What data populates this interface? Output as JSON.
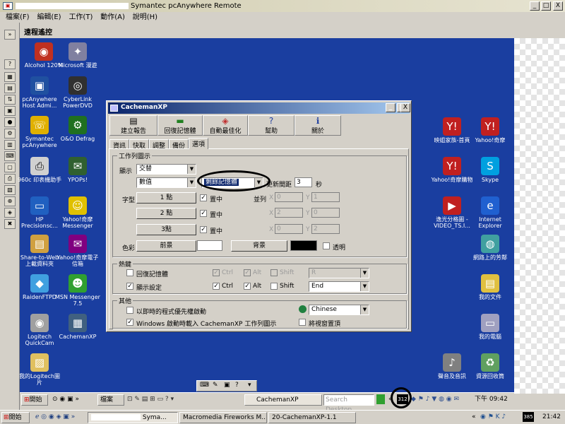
{
  "outer_window": {
    "title": "Symantec pcAnywhere Remote",
    "menu": [
      "檔案(F)",
      "編輯(E)",
      "工作(T)",
      "動作(A)",
      "說明(H)"
    ],
    "min_label": "_",
    "max_label": "□",
    "close_label": "X"
  },
  "remote_header": {
    "title": "遠程遙控"
  },
  "desktop_icons": [
    {
      "label": "Alcohol 120%",
      "icon": "alcohol-icon",
      "color": "#c03020"
    },
    {
      "label": "Microsoft 漫遊",
      "icon": "microsoft-agent-icon",
      "color": "#8080a0"
    },
    {
      "label": "pcAnywhere Host Admi...",
      "icon": "pcanywhere-host-icon",
      "color": "#2050a0"
    },
    {
      "label": "CyberLink PowerDVD",
      "icon": "powerdvd-icon",
      "color": "#303030"
    },
    {
      "label": "Symantec pcAnywhere",
      "icon": "pcanywhere-icon",
      "color": "#e0b000"
    },
    {
      "label": "O&O Defrag",
      "icon": "defrag-icon",
      "color": "#207020"
    },
    {
      "label": "960c 印表機助手",
      "icon": "printer-helper-icon",
      "color": "#d0d0d0"
    },
    {
      "label": "YPOPs!",
      "icon": "ypops-icon",
      "color": "#306030"
    },
    {
      "label": "HP Precisionsc...",
      "icon": "hp-scan-icon",
      "color": "#2060c0"
    },
    {
      "label": "Yahoo!奇摩 Messenger",
      "icon": "yahoo-messenger-icon",
      "color": "#e0c000"
    },
    {
      "label": "Share-to-Web 上載資料夾",
      "icon": "share-folder-icon",
      "color": "#d0a040"
    },
    {
      "label": "Yahoo!奇摩電子信箱",
      "icon": "yahoo-mail-icon",
      "color": "#800080"
    },
    {
      "label": "RaidenFTPD",
      "icon": "ftpd-icon",
      "color": "#40a0e0"
    },
    {
      "label": "MSN Messenger 7.5",
      "icon": "msn-icon",
      "color": "#30a030"
    },
    {
      "label": "Logitech QuickCam",
      "icon": "quickcam-icon",
      "color": "#a0a0a0"
    },
    {
      "label": "CachemanXP",
      "icon": "cacheman-icon",
      "color": "#406080"
    },
    {
      "label": "我的Logitech圖片",
      "icon": "logitech-pictures-icon",
      "color": "#e0c060"
    },
    {
      "label": "映姐家族-首頁",
      "icon": "yahoo-home-icon",
      "color": "#c02020"
    },
    {
      "label": "Yahoo!奇摩",
      "icon": "yahoo-icon",
      "color": "#c02020"
    },
    {
      "label": "Yahoo!奇摩購物",
      "icon": "yahoo-shop-icon",
      "color": "#c02020"
    },
    {
      "label": "Skype",
      "icon": "skype-icon",
      "color": "#00a0e0"
    },
    {
      "label": "逸光分格圖 - VIDEO_TS.I...",
      "icon": "video-icon",
      "color": "#c02020"
    },
    {
      "label": "Internet Explorer",
      "icon": "ie-icon",
      "color": "#2060d0"
    },
    {
      "label": "網路上的芳鄰",
      "icon": "network-icon",
      "color": "#40a0a0"
    },
    {
      "label": "我的文件",
      "icon": "my-documents-icon",
      "color": "#e0c040"
    },
    {
      "label": "我的電腦",
      "icon": "my-computer-icon",
      "color": "#a0a0c0"
    },
    {
      "label": "聲音及音訊",
      "icon": "sound-icon",
      "color": "#808080"
    },
    {
      "label": "資源回收筒",
      "icon": "recycle-bin-icon",
      "color": "#60a060"
    }
  ],
  "dialog": {
    "title": "CachemanXP",
    "toolbar": [
      "建立報告",
      "回復記憶體",
      "自動最佳化",
      "幫助",
      "關於"
    ],
    "tabs": [
      "資訊",
      "快取",
      "調整",
      "備份",
      "選項"
    ],
    "tray_group": {
      "legend": "工作列圖示",
      "display_label": "顯示",
      "display_value": "交替",
      "number_value": "數值",
      "memory_value": "剩餘記憶體",
      "interval_label": "更新間距",
      "interval_value": "3",
      "interval_unit": "秒",
      "font_label": "字型",
      "dot_buttons": [
        "1 點",
        "2 點",
        "3點"
      ],
      "center_label": "置中",
      "arrange_label": "並列",
      "x_label": "X",
      "y_label": "Y",
      "x_values": [
        "0",
        "2",
        "0"
      ],
      "y_values": [
        "1",
        "0",
        "2"
      ],
      "color_label": "色彩",
      "fg_button": "前景",
      "bg_button": "背景",
      "transparent_label": "透明"
    },
    "hotkey_group": {
      "legend": "熱鍵",
      "rows": [
        {
          "label": "回復記憶體",
          "checked": false,
          "ctrl": "Ctrl",
          "alt": "Alt",
          "shift": "Shift",
          "key": "R",
          "enabled": false
        },
        {
          "label": "顯示設定",
          "checked": true,
          "ctrl": "Ctrl",
          "alt": "Alt",
          "shift": "Shift",
          "key": "End",
          "enabled": true
        }
      ]
    },
    "other_group": {
      "legend": "其他",
      "priority_label": "以即時的程式優先權啟動",
      "startup_label": "Windows 啟動時載入 CachemanXP 工作列圖示",
      "language_value": "Chinese",
      "ontop_label": "將視窗置頂"
    }
  },
  "remote_taskbar": {
    "start_label": "開始",
    "items": [
      "檔案",
      "CachemanXP"
    ],
    "search_placeholder": "Search Desktop",
    "tray_badge": "312",
    "clock": "下午 09:42"
  },
  "local_taskbar": {
    "start_label": "開始",
    "items": [
      "Syma...",
      "Macromedia Fireworks M...",
      "20-CachemanXP-1.1"
    ],
    "tray_badge": "385",
    "clock": "21:42"
  },
  "colors": {
    "desktop": "#1a3ea0",
    "dialog_title": "#0a246a",
    "highlight": "#0a246a"
  }
}
